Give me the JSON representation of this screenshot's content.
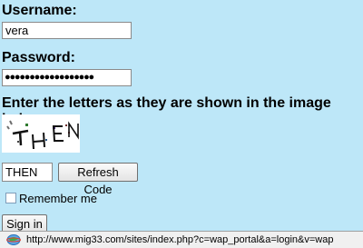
{
  "form": {
    "username_label": "Username:",
    "username_value": "vera",
    "password_label": "Password:",
    "password_value": "●●●●●●●●●●●●●●●●●●",
    "captcha_instruction": "Enter the letters as they are shown in the image below:",
    "captcha_text": "THEN",
    "captcha_input_value": "THEN",
    "refresh_button": "Refresh Code",
    "remember_label": "Remember me",
    "remember_checked": false,
    "signin_button": "Sign in"
  },
  "statusbar": {
    "icon": "web-page-icon",
    "url": "http://www.mig33.com/sites/index.php?c=wap_portal&a=login&v=wap"
  },
  "colors": {
    "page_background": "#bde7f8",
    "statusbar_background": "#f0f0f0"
  }
}
